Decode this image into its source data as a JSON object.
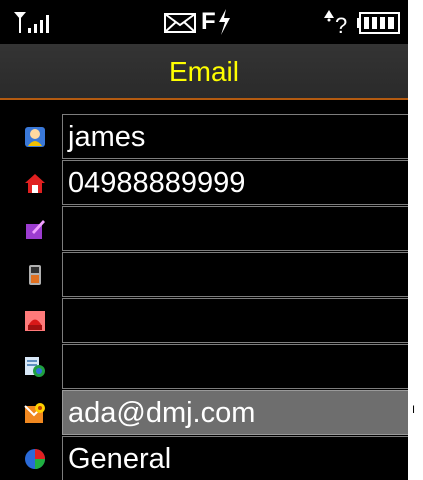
{
  "status_bar": {
    "signal_icon": "signal-strength-icon",
    "message_icon": "envelope-icon",
    "indicator_text": "F",
    "alarm_icon": "alarm-bell-icon",
    "unknown_text": "?",
    "battery_icon": "battery-icon"
  },
  "title": "Email",
  "fields": [
    {
      "icon": "contact-person-icon",
      "value": ""
    },
    {
      "icon": "home-phone-icon",
      "value": ""
    },
    {
      "icon": "work-note-icon",
      "value": ""
    },
    {
      "icon": "mobile-phone-icon",
      "value": ""
    },
    {
      "icon": "office-phone-icon",
      "value": ""
    },
    {
      "icon": "fax-globe-icon",
      "value": ""
    },
    {
      "icon": "email-icon",
      "value": "ada@dmj.com"
    },
    {
      "icon": "group-pie-icon",
      "value": "General"
    }
  ],
  "names": {
    "first": "james",
    "home_number": "04988889999"
  },
  "colors": {
    "title": "#ffff00",
    "accent_line": "#b35a10",
    "selected_row": "#6e6e6e"
  }
}
